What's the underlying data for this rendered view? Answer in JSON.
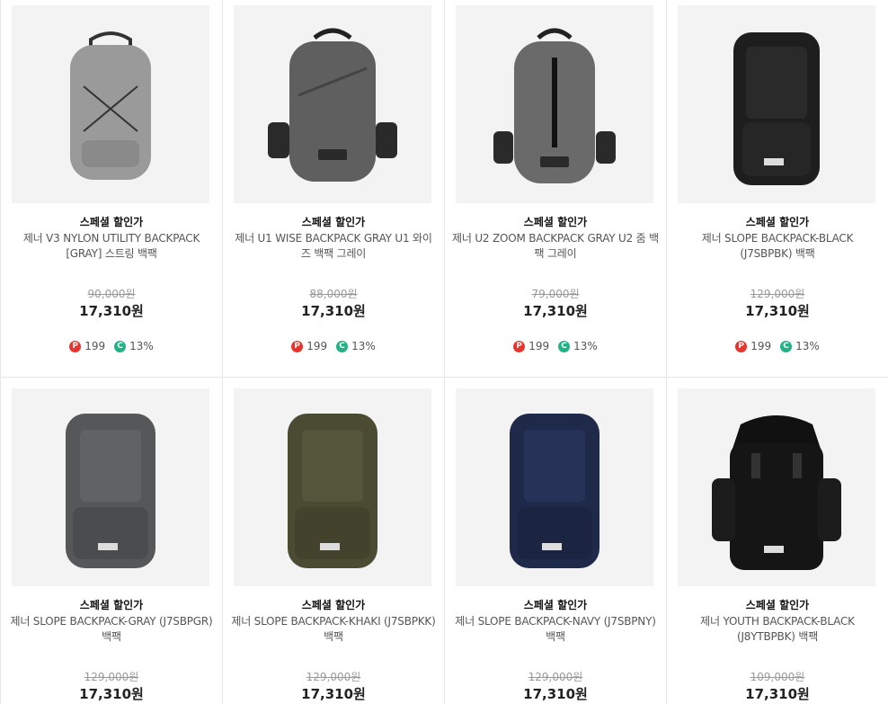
{
  "products": [
    {
      "badge": "스페셜 할인가",
      "name": "제너 V3 NYLON UTILITY BACKPACK [GRAY] 스트링 백팩",
      "original_price": "90,000원",
      "price": "17,310원",
      "points": "199",
      "coupon": "13%",
      "image": "gray-utility-backpack",
      "bag_color": "#9a9a9a",
      "points_icon": "P",
      "coupon_icon": "C"
    },
    {
      "badge": "스페셜 할인가",
      "name": "제너 U1 WISE BACKPACK GRAY U1 와이즈 백팩 그레이",
      "original_price": "88,000원",
      "price": "17,310원",
      "points": "199",
      "coupon": "13%",
      "image": "gray-wise-backpack",
      "bag_color": "#5f5f5f",
      "points_icon": "P",
      "coupon_icon": "C"
    },
    {
      "badge": "스페셜 할인가",
      "name": "제너 U2 ZOOM BACKPACK GRAY U2 줌 백팩 그레이",
      "original_price": "79,000원",
      "price": "17,310원",
      "points": "199",
      "coupon": "13%",
      "image": "gray-zoom-backpack",
      "bag_color": "#6a6a6a",
      "points_icon": "P",
      "coupon_icon": "C"
    },
    {
      "badge": "스페셜 할인가",
      "name": "제너 SLOPE BACKPACK-BLACK (J7SBPBK) 백팩",
      "original_price": "129,000원",
      "price": "17,310원",
      "points": "199",
      "coupon": "13%",
      "image": "black-slope-backpack",
      "bag_color": "#1e1e1e",
      "points_icon": "P",
      "coupon_icon": "C"
    },
    {
      "badge": "스페셜 할인가",
      "name": "제너 SLOPE BACKPACK-GRAY (J7SBPGR) 백팩",
      "original_price": "129,000원",
      "price": "17,310원",
      "image": "gray-slope-backpack",
      "bag_color": "#555758"
    },
    {
      "badge": "스페셜 할인가",
      "name": "제너 SLOPE BACKPACK-KHAKI (J7SBPKK) 백팩",
      "original_price": "129,000원",
      "price": "17,310원",
      "image": "khaki-slope-backpack",
      "bag_color": "#4b4b34"
    },
    {
      "badge": "스페셜 할인가",
      "name": "제너 SLOPE BACKPACK-NAVY (J7SBPNY) 백팩",
      "original_price": "129,000원",
      "price": "17,310원",
      "image": "navy-slope-backpack",
      "bag_color": "#1f2a4a"
    },
    {
      "badge": "스페셜 할인가",
      "name": "제너 YOUTH BACKPACK-BLACK (J8YTBPBK) 백팩",
      "original_price": "109,000원",
      "price": "17,310원",
      "image": "black-youth-backpack",
      "bag_color": "#151515"
    }
  ]
}
